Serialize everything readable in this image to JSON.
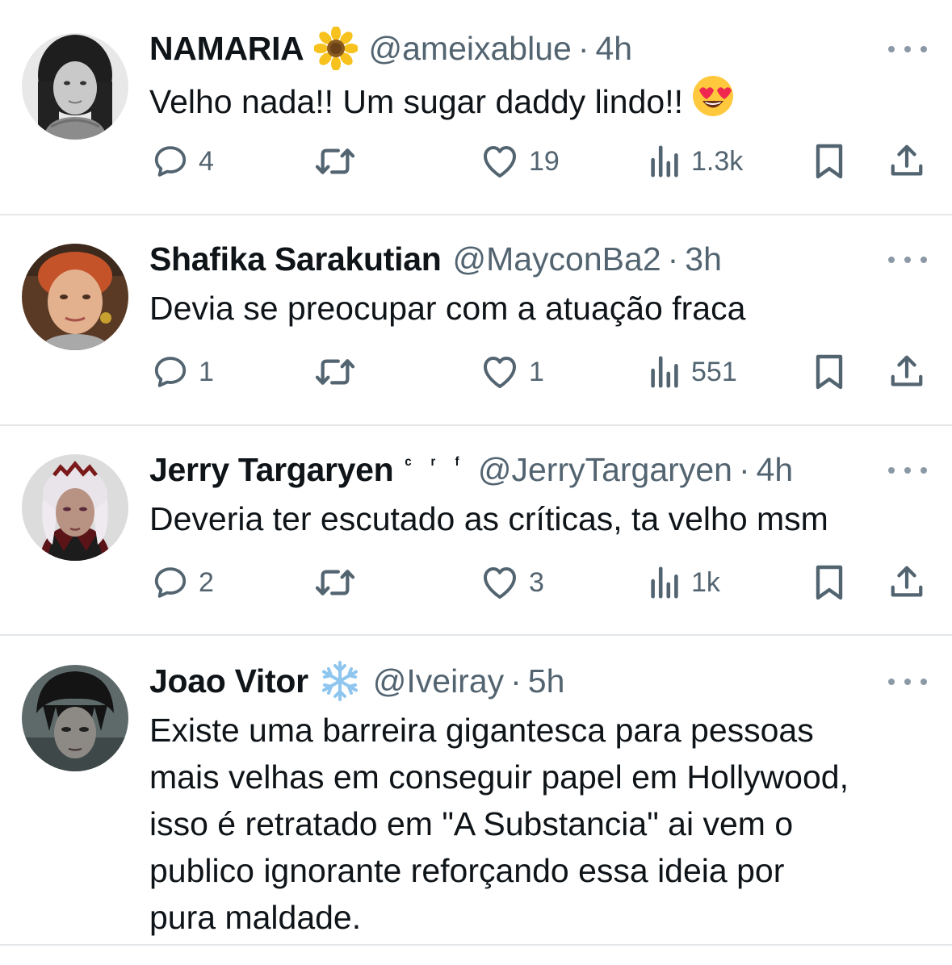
{
  "tweets": [
    {
      "name": "NAMARIA",
      "badge": "sunflower-emoji",
      "handle": "@ameixablue",
      "time": "4h",
      "text": "Velho nada!! Um sugar daddy lindo!!",
      "text_emoji": "heart-eyes-emoji",
      "replies": "4",
      "reposts": "",
      "likes": "19",
      "views": "1.3k"
    },
    {
      "name": "Shafika Sarakutian",
      "handle": "@MayconBa2",
      "time": "3h",
      "text": "Devia se preocupar com a atuação fraca",
      "replies": "1",
      "reposts": "",
      "likes": "1",
      "views": "551"
    },
    {
      "name": "Jerry Targaryen",
      "name_suffix": "ᶜ ʳ ᶠ",
      "handle": "@JerryTargaryen",
      "time": "4h",
      "text": "Deveria ter escutado as críticas, ta velho msm",
      "replies": "2",
      "reposts": "",
      "likes": "3",
      "views": "1k"
    },
    {
      "name": "Joao Vitor",
      "badge": "snowflake-emoji",
      "handle": "@Iveiray",
      "time": "5h",
      "text_lines": [
        "Existe uma barreira gigantesca para pessoas",
        "mais velhas em conseguir papel em Hollywood,",
        "isso é retratado em \"A Substancia\" ai vem o",
        "publico ignorante reforçando essa ideia por",
        "pura maldade."
      ]
    }
  ],
  "separator": "·",
  "colors": {
    "text": "#0f1419",
    "secondary": "#536471",
    "divider": "#e3e6e9"
  }
}
